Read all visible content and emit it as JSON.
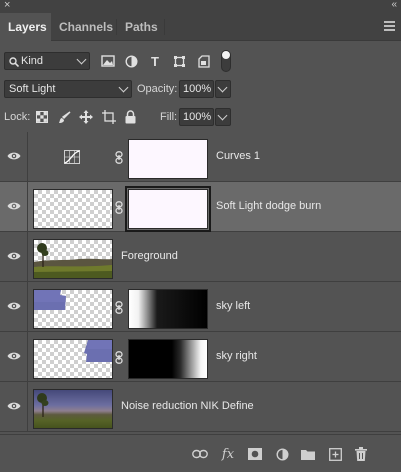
{
  "window": {
    "close_glyph": "×",
    "collapse_glyph": "«"
  },
  "tabs": [
    {
      "label": "Layers",
      "active": true
    },
    {
      "label": "Channels",
      "active": false
    },
    {
      "label": "Paths",
      "active": false
    }
  ],
  "filter": {
    "kind_label": "Kind",
    "icons": [
      "pixel-filter-icon",
      "adjustment-filter-icon",
      "type-filter-icon",
      "shape-filter-icon",
      "smart-object-filter-icon",
      "filter-toggle-icon"
    ]
  },
  "blend": {
    "mode": "Soft Light",
    "opacity_label": "Opacity:",
    "opacity_value": "100%"
  },
  "lock": {
    "label": "Lock:",
    "fill_label": "Fill:",
    "fill_value": "100%",
    "icons": [
      "lock-transparent-icon",
      "lock-paint-icon",
      "lock-position-icon",
      "lock-artboard-icon",
      "lock-all-icon"
    ]
  },
  "layers": [
    {
      "name": "Curves 1",
      "type": "adjustment",
      "selected": false
    },
    {
      "name": "Soft Light dodge burn",
      "type": "masked",
      "selected": true
    },
    {
      "name": "Foreground",
      "type": "image",
      "selected": false
    },
    {
      "name": "sky left",
      "type": "masked",
      "selected": false
    },
    {
      "name": "sky right",
      "type": "masked",
      "selected": false
    },
    {
      "name": "Noise reduction NIK Define",
      "type": "image",
      "selected": false
    }
  ],
  "bottom_icons": [
    "link-layers-icon",
    "layer-style-icon",
    "add-mask-icon",
    "new-adjustment-icon",
    "new-group-icon",
    "new-layer-icon",
    "delete-layer-icon"
  ],
  "bottom_fx_label": "fx",
  "colors": {
    "panel_bg": "#535353",
    "selected_row": "#6a6a6a",
    "tab_bar": "#424242"
  }
}
